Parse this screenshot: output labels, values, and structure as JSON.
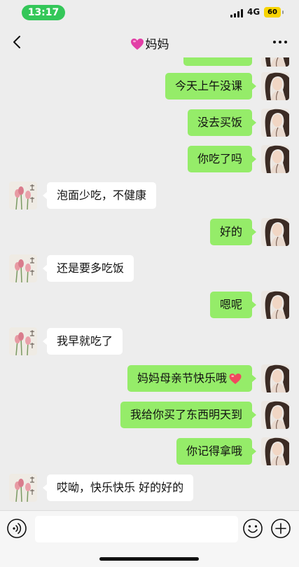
{
  "status_bar": {
    "time": "13:17",
    "network": "4G",
    "battery": "60"
  },
  "nav": {
    "title": "妈妈",
    "title_emoji_icon": "pink-heart-icon"
  },
  "messages": [
    {
      "from": "me",
      "text": ""
    },
    {
      "from": "me",
      "text": "今天上午没课"
    },
    {
      "from": "me",
      "text": "没去买饭"
    },
    {
      "from": "me",
      "text": "你吃了吗"
    },
    {
      "from": "other",
      "text": "泡面少吃，不健康"
    },
    {
      "from": "me",
      "text": "好的"
    },
    {
      "from": "other",
      "text": "还是要多吃饭"
    },
    {
      "from": "me",
      "text": "嗯呢"
    },
    {
      "from": "other",
      "text": "我早就吃了"
    },
    {
      "from": "me",
      "text": "妈妈母亲节快乐哦",
      "trailing_icon": "red-heart-icon"
    },
    {
      "from": "me",
      "text": "我给你买了东西明天到"
    },
    {
      "from": "me",
      "text": "你记得拿哦"
    },
    {
      "from": "other",
      "text": "哎呦，快乐快乐 好的好的"
    }
  ],
  "input_bar": {
    "voice_icon": "voice-icon",
    "emoji_icon": "smile-emoji-icon",
    "plus_icon": "plus-icon",
    "placeholder": ""
  },
  "colors": {
    "my_bubble": "#95ec69",
    "other_bubble": "#ffffff",
    "background": "#ededed",
    "time_pill": "#34c759",
    "battery": "#f7d400"
  }
}
